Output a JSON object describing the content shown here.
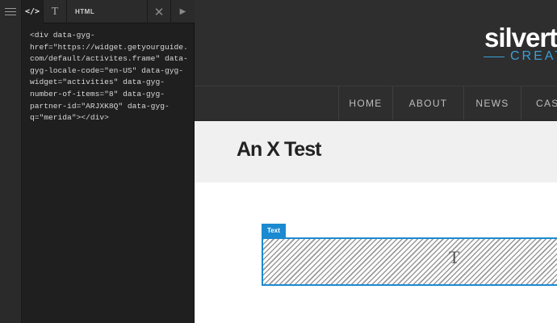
{
  "editor": {
    "tabs": {
      "code_icon": "</>",
      "text_icon": "T",
      "html_label": "HTML",
      "close_icon": "✕",
      "play_icon": "▶"
    },
    "code": "<div data-gyg-\nhref=\"https://widget.getyourguide.\ncom/default/activites.frame\" data-\ngyg-locale-code=\"en-US\" data-gyg-\nwidget=\"activities\" data-gyg-\nnumber-of-items=\"8\" data-gyg-\npartner-id=\"ARJXK8Q\" data-gyg-\nq=\"merida\"></div>"
  },
  "site": {
    "logo_main": "silvert",
    "logo_sub": "CREAT",
    "nav": [
      "HOME",
      "ABOUT",
      "NEWS",
      "CAS"
    ],
    "page_title": "An X Test",
    "text_block_label": "Text",
    "text_block_icon": "T"
  },
  "colors": {
    "accent": "#1b8ad0",
    "logo_accent": "#3aa0d8",
    "header_bg": "#2e2e2e"
  }
}
